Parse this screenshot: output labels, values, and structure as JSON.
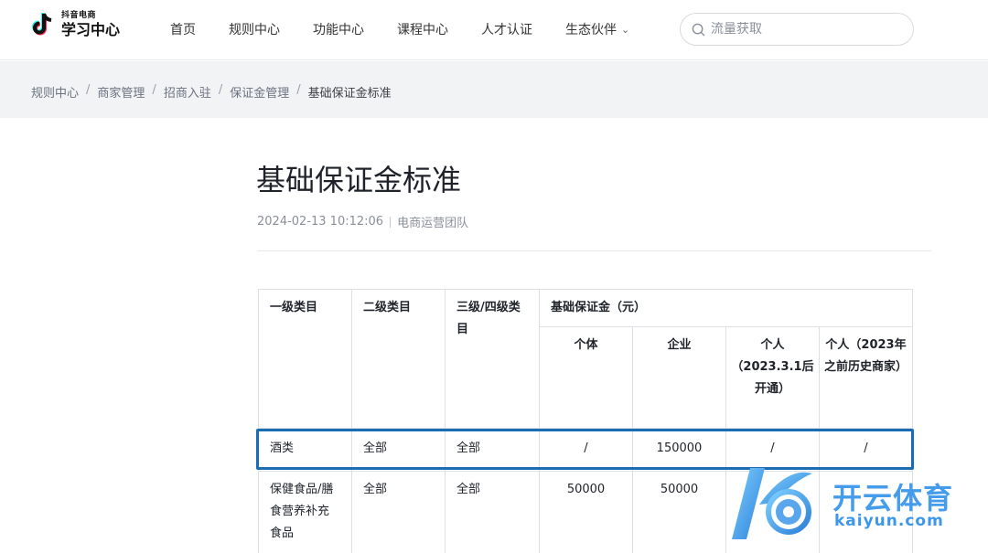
{
  "header": {
    "logo": {
      "brand": "抖音电商",
      "name": "学习中心"
    },
    "nav": [
      {
        "label": "首页"
      },
      {
        "label": "规则中心"
      },
      {
        "label": "功能中心"
      },
      {
        "label": "课程中心"
      },
      {
        "label": "人才认证"
      },
      {
        "label": "生态伙伴",
        "has_dropdown": true
      }
    ],
    "search": {
      "placeholder": "流量获取",
      "icon": "search-icon"
    }
  },
  "breadcrumb": {
    "items": [
      "规则中心",
      "商家管理",
      "招商入驻",
      "保证金管理"
    ],
    "current": "基础保证金标准",
    "separator": "/"
  },
  "article": {
    "title": "基础保证金标准",
    "date": "2024-02-13 10:12:06",
    "author": "电商运营团队"
  },
  "table": {
    "headers": {
      "col1": "一级类目",
      "col2": "二级类目",
      "col3": "三级/四级类目",
      "group": "基础保证金（元）",
      "sub": [
        "个体",
        "企业",
        "个人（2023.3.1后开通）",
        "个人（2023年之前历史商家）"
      ]
    },
    "rows": [
      {
        "c1": "酒类",
        "c2": "全部",
        "c3": "全部",
        "v": [
          "/",
          "150000",
          "/",
          "/"
        ],
        "highlighted": true
      },
      {
        "c1": "保健食品/膳食营养补充食品",
        "c2": "全部",
        "c3": "全部",
        "v": [
          "50000",
          "50000",
          "",
          ""
        ]
      }
    ]
  },
  "watermark": {
    "text": "开云体育",
    "domain": "kaiyun.com"
  },
  "colors": {
    "highlight": "#1a6cb3",
    "watermark": "#3c97ea",
    "breadcrumb_bg": "#f2f3f5"
  }
}
